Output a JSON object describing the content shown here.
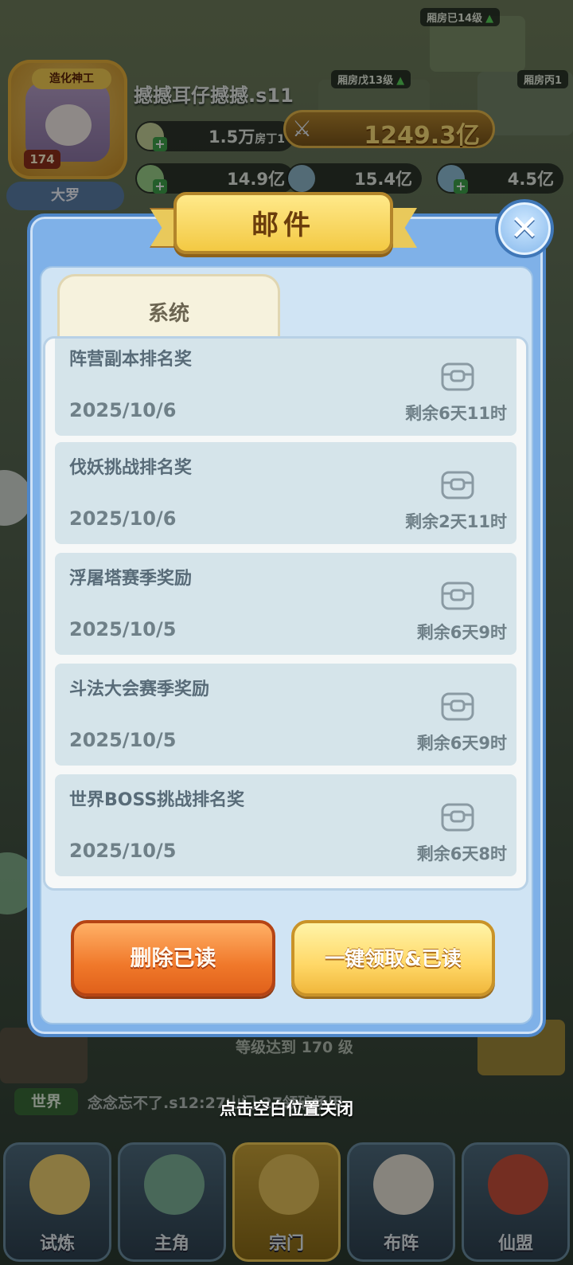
{
  "background": {
    "player": {
      "title_badge": "造化神工",
      "level": "174",
      "rank": "大罗",
      "name": "撼撼耳仔撼撼.s11"
    },
    "resources": {
      "res1": "1.5万",
      "res1_suffix": "房丁1",
      "res2": "14.9亿",
      "res3": "15.4亿",
      "res4": "4.5亿",
      "power": "1249.3亿"
    },
    "buildings": [
      {
        "label": "厢房已14级"
      },
      {
        "label": "厢房戊13级"
      },
      {
        "label": "厢房丙1"
      }
    ],
    "level_hint": "等级达到 170 级",
    "chat": {
      "channel": "世界",
      "message": "念念忘不了.s12:27山门  27领矿场甲"
    },
    "nav": [
      {
        "label": "试炼"
      },
      {
        "label": "主角"
      },
      {
        "label": "宗门"
      },
      {
        "label": "布阵"
      },
      {
        "label": "仙盟"
      }
    ]
  },
  "modal": {
    "title": "邮件",
    "close_glyph": "✕",
    "tab": "系统",
    "mails": [
      {
        "title": "阵营副本排名奖",
        "date": "2025/10/6",
        "remaining": "剩余6天11时"
      },
      {
        "title": "伐妖挑战排名奖",
        "date": "2025/10/6",
        "remaining": "剩余2天11时"
      },
      {
        "title": "浮屠塔赛季奖励",
        "date": "2025/10/5",
        "remaining": "剩余6天9时"
      },
      {
        "title": "斗法大会赛季奖励",
        "date": "2025/10/5",
        "remaining": "剩余6天9时"
      },
      {
        "title": "世界BOSS挑战排名奖",
        "date": "2025/10/5",
        "remaining": "剩余6天8时"
      }
    ],
    "delete_label": "删除已读",
    "claim_label": "一键领取&已读",
    "close_hint": "点击空白位置关闭"
  },
  "colors": {
    "modal_bg": "#7fb1e8",
    "item_bg": "#d5e4ea",
    "delete_btn": "#f0782a",
    "claim_btn": "#ffd766"
  }
}
